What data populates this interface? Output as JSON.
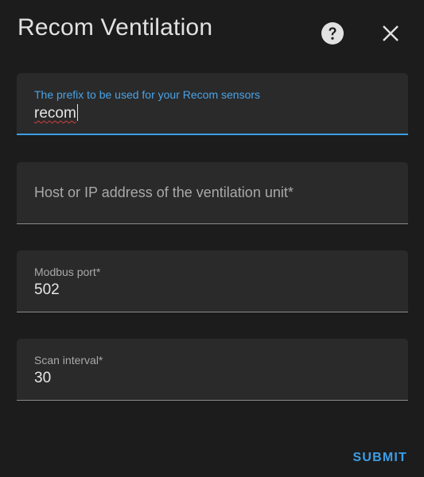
{
  "dialog": {
    "title": "Recom Ventilation",
    "help_icon": "help-circle-icon",
    "close_icon": "close-icon"
  },
  "fields": {
    "prefix": {
      "label": "The prefix to be used for your Recom sensors",
      "value": "recom",
      "focused": true
    },
    "host": {
      "label": "Host or IP address of the ventilation unit*",
      "value": ""
    },
    "port": {
      "label": "Modbus port*",
      "value": "502"
    },
    "scan": {
      "label": "Scan interval*",
      "value": "30"
    }
  },
  "actions": {
    "submit_label": "SUBMIT"
  },
  "colors": {
    "accent": "#3b9ee6",
    "background": "#1c1c1c",
    "field_bg": "#2a2a2a"
  }
}
